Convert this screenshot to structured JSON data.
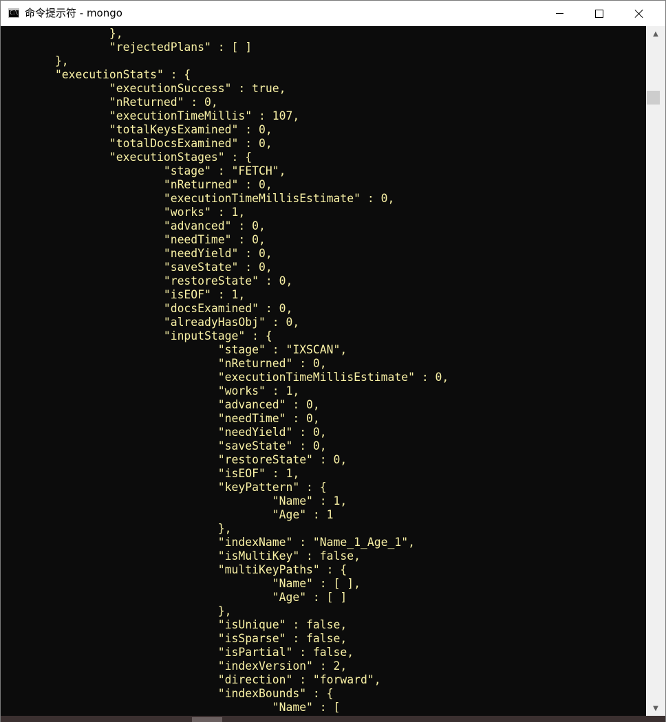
{
  "window": {
    "title": "命令提示符 - mongo",
    "icon": "cmd-prompt-icon",
    "icon_glyph": "C:\\"
  },
  "caption_buttons": {
    "minimize": "minimize-icon",
    "maximize": "maximize-icon",
    "close": "close-icon"
  },
  "colors": {
    "console_bg": "#0c0c0c",
    "console_text": "#f9f1a5",
    "titlebar_bg": "#ffffff",
    "scrollbar_bg": "#f0f0f0"
  },
  "console": {
    "lines": [
      "                },",
      "                \"rejectedPlans\" : [ ]",
      "        },",
      "        \"executionStats\" : {",
      "                \"executionSuccess\" : true,",
      "                \"nReturned\" : 0,",
      "                \"executionTimeMillis\" : 107,",
      "                \"totalKeysExamined\" : 0,",
      "                \"totalDocsExamined\" : 0,",
      "                \"executionStages\" : {",
      "                        \"stage\" : \"FETCH\",",
      "                        \"nReturned\" : 0,",
      "                        \"executionTimeMillisEstimate\" : 0,",
      "                        \"works\" : 1,",
      "                        \"advanced\" : 0,",
      "                        \"needTime\" : 0,",
      "                        \"needYield\" : 0,",
      "                        \"saveState\" : 0,",
      "                        \"restoreState\" : 0,",
      "                        \"isEOF\" : 1,",
      "                        \"docsExamined\" : 0,",
      "                        \"alreadyHasObj\" : 0,",
      "                        \"inputStage\" : {",
      "                                \"stage\" : \"IXSCAN\",",
      "                                \"nReturned\" : 0,",
      "                                \"executionTimeMillisEstimate\" : 0,",
      "                                \"works\" : 1,",
      "                                \"advanced\" : 0,",
      "                                \"needTime\" : 0,",
      "                                \"needYield\" : 0,",
      "                                \"saveState\" : 0,",
      "                                \"restoreState\" : 0,",
      "                                \"isEOF\" : 1,",
      "                                \"keyPattern\" : {",
      "                                        \"Name\" : 1,",
      "                                        \"Age\" : 1",
      "                                },",
      "                                \"indexName\" : \"Name_1_Age_1\",",
      "                                \"isMultiKey\" : false,",
      "                                \"multiKeyPaths\" : {",
      "                                        \"Name\" : [ ],",
      "                                        \"Age\" : [ ]",
      "                                },",
      "                                \"isUnique\" : false,",
      "                                \"isSparse\" : false,",
      "                                \"isPartial\" : false,",
      "                                \"indexVersion\" : 2,",
      "                                \"direction\" : \"forward\",",
      "                                \"indexBounds\" : {",
      "                                        \"Name\" : ["
    ]
  }
}
